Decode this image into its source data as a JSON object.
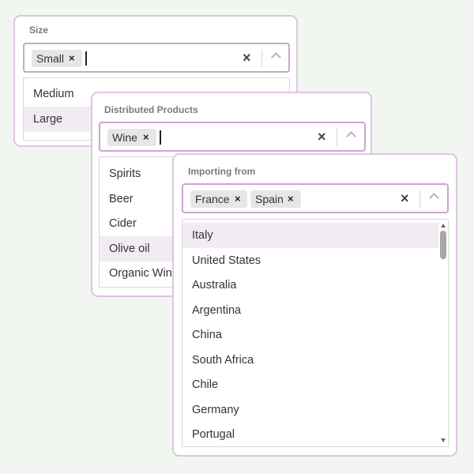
{
  "size_select": {
    "label": "Size",
    "chips": [
      "Small"
    ],
    "options": [
      "Medium",
      "Large"
    ],
    "highlighted": "Large"
  },
  "products_select": {
    "label": "Distributed Products",
    "chips": [
      "Wine"
    ],
    "options": [
      "Spirits",
      "Beer",
      "Cider",
      "Olive oil",
      "Organic Wine"
    ],
    "highlighted": "Olive oil"
  },
  "importing_select": {
    "label": "Importing from",
    "chips": [
      "France",
      "Spain"
    ],
    "options": [
      "Italy",
      "United States",
      "Australia",
      "Argentina",
      "China",
      "South Africa",
      "Chile",
      "Germany",
      "Portugal"
    ],
    "highlighted": "Italy"
  },
  "icons": {
    "chip_remove": "×",
    "clear": "×",
    "toggle": "chevron-up-icon"
  },
  "colors": {
    "background": "#f1f7f0",
    "accent_border": "#c9a6cd",
    "card_border": "#ddc5e0",
    "highlight": "#f3ebf4"
  }
}
